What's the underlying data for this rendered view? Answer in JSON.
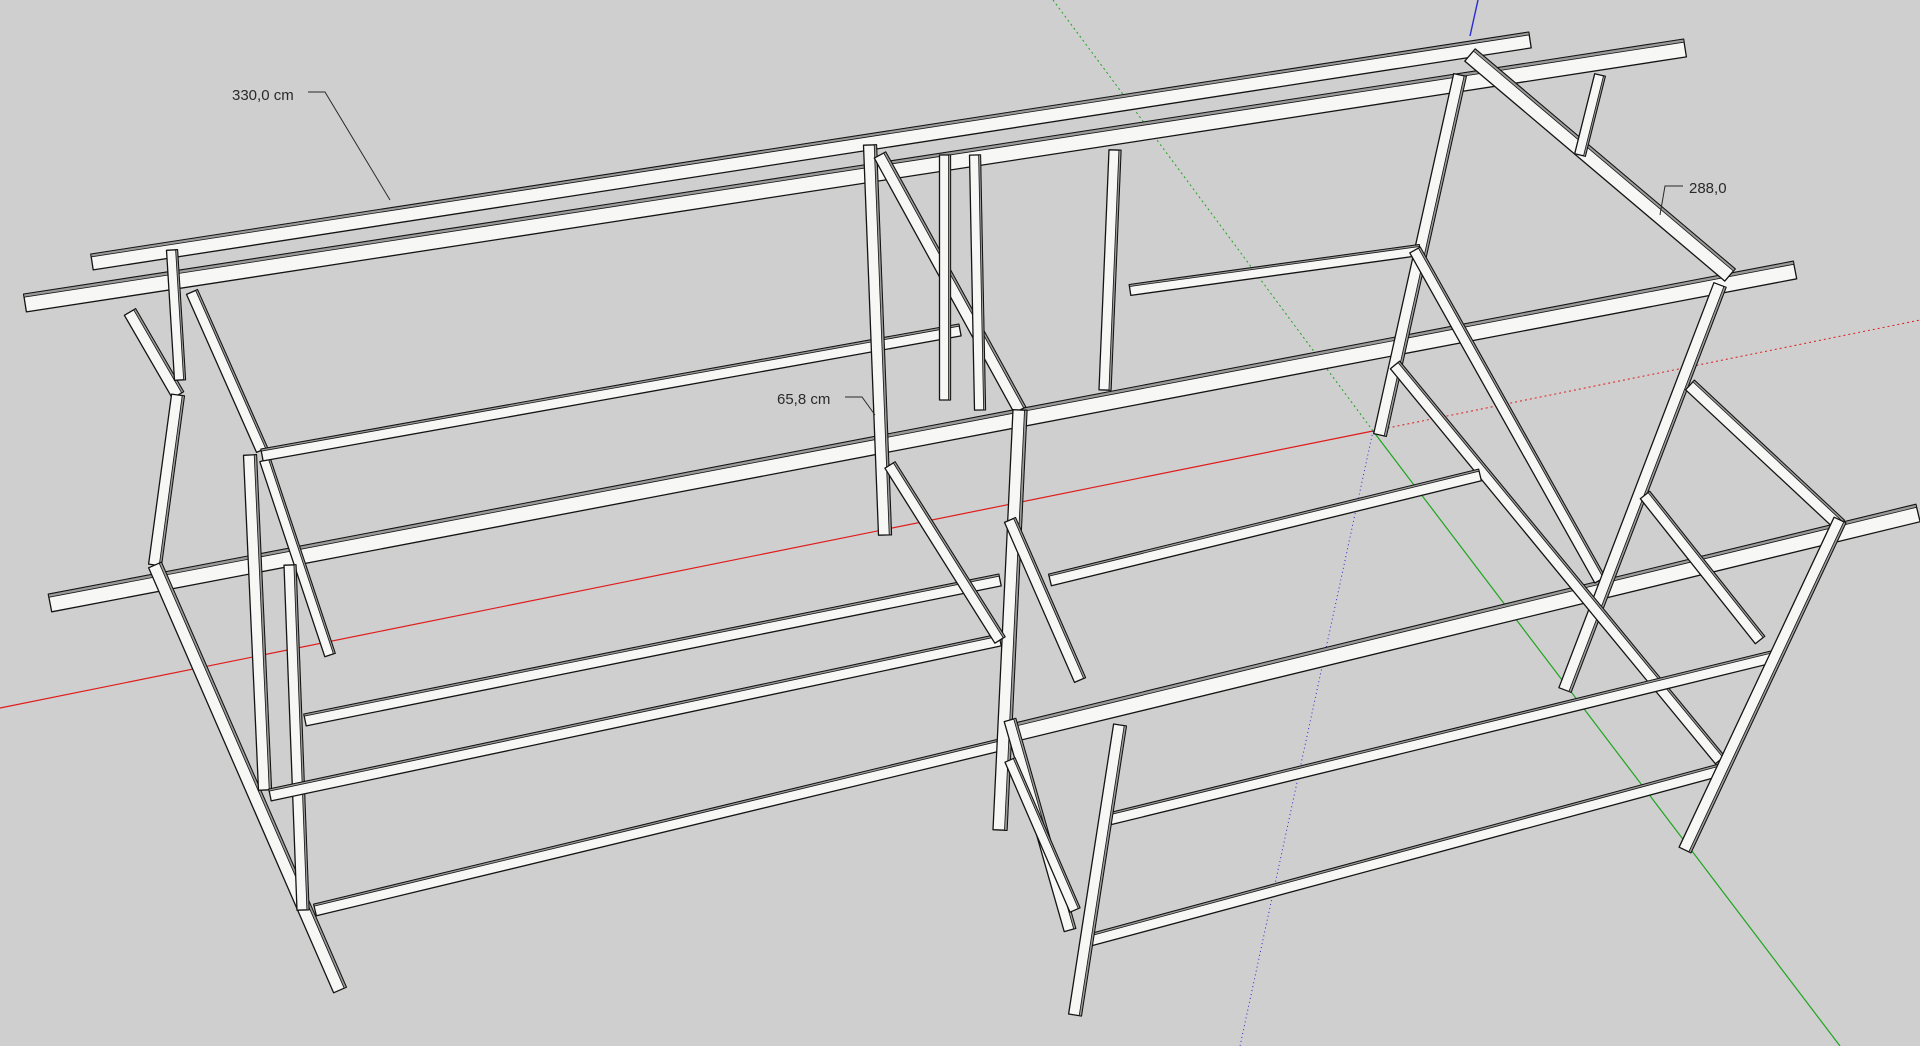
{
  "viewport": {
    "background_color": "#cfcfcf",
    "axes": {
      "x_color": "#e01b1b",
      "y_color": "#1fa51f",
      "z_color": "#2a2ad6"
    },
    "model": {
      "description_icon": "wireframe-shelving-frame",
      "beam_fill": "#f7f7f5",
      "beam_shade": "#9a9a9a",
      "edge_color": "#141414"
    }
  },
  "dimensions": {
    "length_label": "330,0 cm",
    "width_label": "288,0",
    "height_label": "65,8 cm"
  }
}
